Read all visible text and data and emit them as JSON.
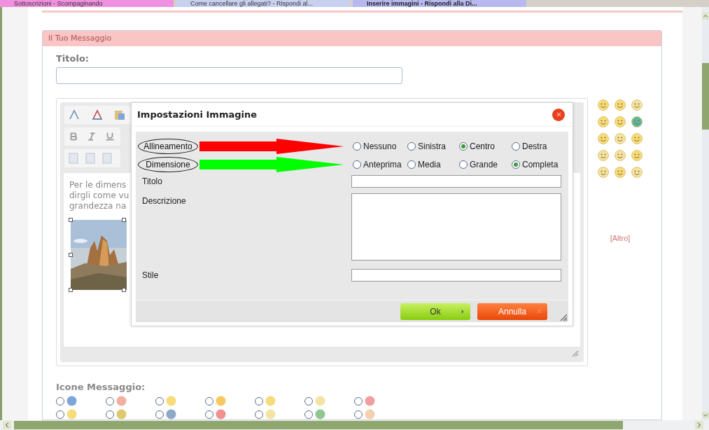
{
  "browser_tabs": [
    {
      "label": "Sottoscrizioni - Scompaginando",
      "selected": false
    },
    {
      "label": "Come cancellare gli allegati? - Rispondi al...",
      "selected": false
    },
    {
      "label": "Inserire immagini - Rispondi alla Di...",
      "selected": true
    }
  ],
  "message_panel": {
    "title": "Il Tuo Messaggio",
    "title_label": "Titolo:",
    "editor_text": [
      "Per le dimens",
      "dirgli come vu",
      "grandezza na"
    ],
    "smileys_more": "[Altro]",
    "icons_label": "Icone Messaggio:"
  },
  "message_icons": [
    {
      "selected": false
    },
    {
      "selected": false
    },
    {
      "selected": false
    },
    {
      "selected": false
    },
    {
      "selected": false
    },
    {
      "selected": false
    },
    {
      "selected": false
    },
    {
      "selected": false
    },
    {
      "selected": false
    },
    {
      "selected": false
    },
    {
      "selected": false
    },
    {
      "selected": false
    },
    {
      "selected": false
    },
    {
      "selected": false
    }
  ],
  "dialog": {
    "title": "Impostazioni Immagine",
    "option_rows": [
      {
        "label": "Allineamento",
        "color": "#ff0000",
        "options": [
          {
            "label": "Nessuno",
            "selected": false
          },
          {
            "label": "Sinistra",
            "selected": false
          },
          {
            "label": "Centro",
            "selected": true
          },
          {
            "label": "Destra",
            "selected": false
          }
        ]
      },
      {
        "label": "Dimensione",
        "color": "#00ff00",
        "options": [
          {
            "label": "Anteprima",
            "selected": false
          },
          {
            "label": "Media",
            "selected": false
          },
          {
            "label": "Grande",
            "selected": false
          },
          {
            "label": "Completa",
            "selected": true
          }
        ]
      }
    ],
    "fields": [
      {
        "label": "Titolo",
        "kind": "input"
      },
      {
        "label": "Descrizione",
        "kind": "textarea"
      },
      {
        "label": "Stile",
        "kind": "input"
      }
    ],
    "buttons": [
      {
        "label": "Ok",
        "kind": "ok"
      },
      {
        "label": "Annulla",
        "kind": "cancel"
      }
    ]
  }
}
